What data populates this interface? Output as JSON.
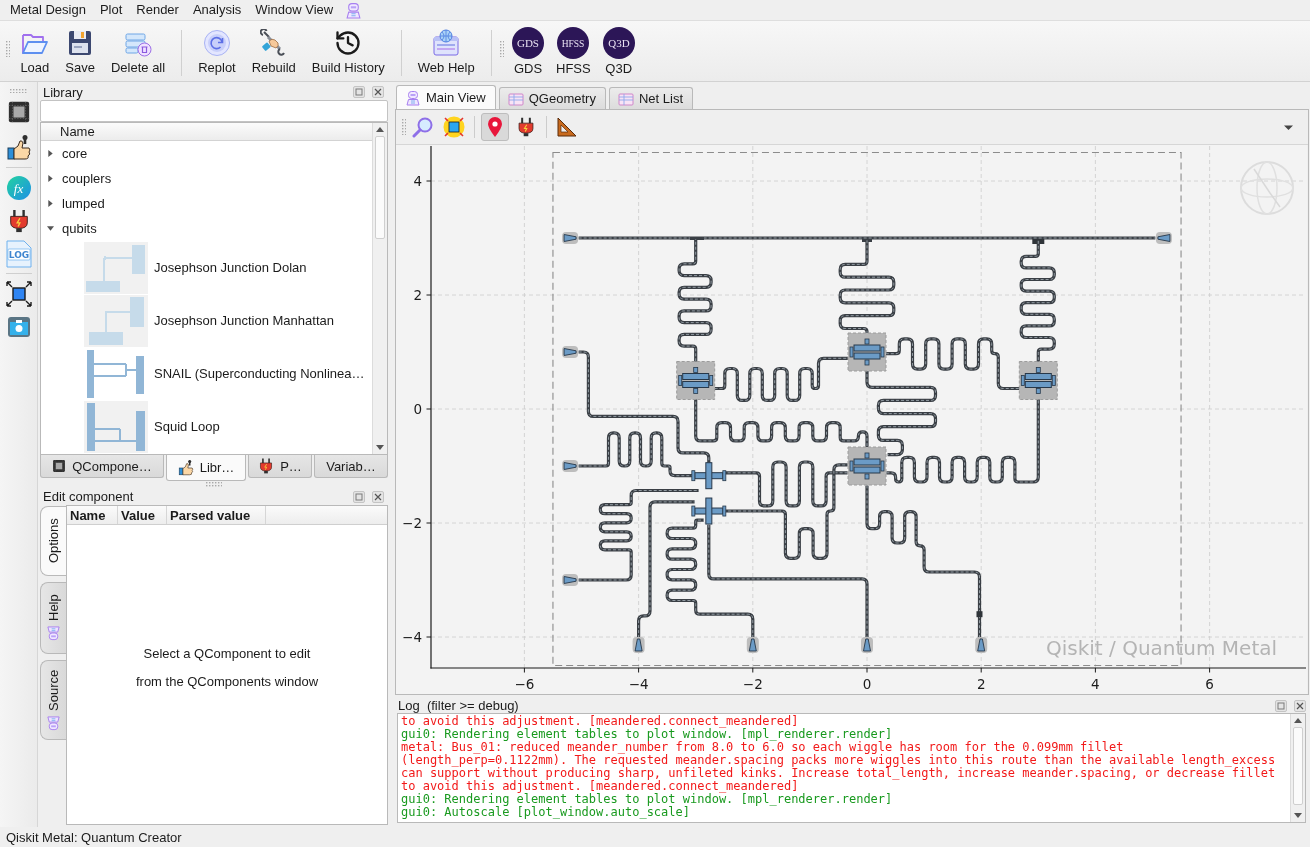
{
  "menu": {
    "items": [
      "Metal Design",
      "Plot",
      "Render",
      "Analysis",
      "Window View"
    ]
  },
  "toolbar": {
    "groups": [
      [
        {
          "label": "Load"
        },
        {
          "label": "Save"
        },
        {
          "label": "Delete all"
        }
      ],
      [
        {
          "label": "Replot"
        },
        {
          "label": "Rebuild"
        },
        {
          "label": "Build History"
        }
      ],
      [
        {
          "label": "Web Help"
        }
      ],
      [
        {
          "label": "GDS",
          "badge": "GDS"
        },
        {
          "label": "HFSS",
          "badge": "HFSS"
        },
        {
          "label": "Q3D",
          "badge": "Q3D"
        }
      ]
    ]
  },
  "side_toolbar": {
    "fx_text": "fx",
    "log_text": "LOG"
  },
  "library": {
    "title": "Library",
    "columns": [
      "Name"
    ],
    "tree": [
      {
        "label": "core",
        "expanded": false
      },
      {
        "label": "couplers",
        "expanded": false
      },
      {
        "label": "lumped",
        "expanded": false
      },
      {
        "label": "qubits",
        "expanded": true,
        "children": [
          {
            "label": "Josephson Junction Dolan"
          },
          {
            "label": "Josephson Junction Manhattan"
          },
          {
            "label": "SNAIL (Superconducting Nonlinea…"
          },
          {
            "label": "Squid Loop"
          }
        ]
      }
    ],
    "tabs": [
      {
        "label": "QCompone…",
        "selected": false
      },
      {
        "label": "Libr…",
        "selected": true
      },
      {
        "label": "P…",
        "selected": false
      },
      {
        "label": "Variab…",
        "selected": false
      }
    ]
  },
  "edit_component": {
    "title": "Edit component",
    "side_tabs": [
      {
        "label": "Options",
        "selected": true
      },
      {
        "label": "Help",
        "selected": false
      },
      {
        "label": "Source",
        "selected": false
      }
    ],
    "columns": [
      "Name",
      "Value",
      "Parsed value"
    ],
    "empty_message": {
      "lines": [
        "Select a QComponent to edit",
        "from the QComponents window"
      ]
    }
  },
  "main_tabs": [
    {
      "label": "Main View",
      "selected": true
    },
    {
      "label": "QGeometry",
      "selected": false
    },
    {
      "label": "Net List",
      "selected": false
    }
  ],
  "view_toolbar": {
    "tools": [
      {
        "selected": false
      },
      {
        "selected": false
      },
      {
        "selected": true
      },
      {
        "selected": false
      },
      {
        "selected": false
      }
    ]
  },
  "plot": {
    "xticks": [
      "−6",
      "−4",
      "−2",
      "0",
      "2",
      "4",
      "6"
    ],
    "yticks": [
      "4",
      "2",
      "0",
      "−2",
      "−4"
    ],
    "watermark": "Qiskit / Quantum Metal"
  },
  "log": {
    "title": "Log  (filter >= debug)",
    "lines": [
      {
        "color": "#f21a1a",
        "text": "to avoid this adjustment. [meandered.connect_meandered]"
      },
      {
        "color": "#199a1f",
        "text": "gui0: Rendering element tables to plot window. [mpl_renderer.render]"
      },
      {
        "color": "#f21a1a",
        "text": "metal: Bus_01: reduced meander_number from 8.0 to 6.0 so each wiggle has room for the 0.099mm fillet"
      },
      {
        "color": "#f21a1a",
        "text": "(length_perp=0.1122mm). The requested meander.spacing packs more wiggles into this route than the available length_excess"
      },
      {
        "color": "#f21a1a",
        "text": "can support without producing sharp, unfileted kinks. Increase total_length, increase meander.spacing, or decrease fillet"
      },
      {
        "color": "#f21a1a",
        "text": "to avoid this adjustment. [meandered.connect_meandered]"
      },
      {
        "color": "#199a1f",
        "text": "gui0: Rendering element tables to plot window. [mpl_renderer.render]"
      },
      {
        "color": "#199a1f",
        "text": "gui0: Autoscale [plot_window.auto_scale]"
      }
    ]
  },
  "status_bar": "Qiskit Metal: Quantum Creator"
}
